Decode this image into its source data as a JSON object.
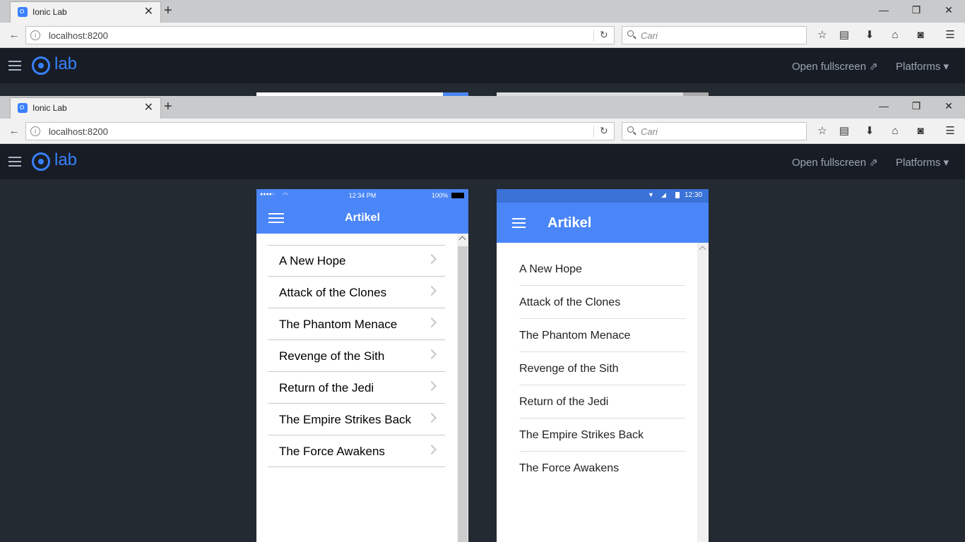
{
  "browser": {
    "tab_title": "Ionic Lab",
    "tab_close": "✕",
    "new_tab": "+",
    "url": "localhost:8200",
    "search_placeholder": "Cari",
    "win_minimize": "—",
    "win_restore": "❐",
    "win_close": "✕"
  },
  "lab": {
    "logo_text": "lab",
    "open_fullscreen": "Open fullscreen ⇗",
    "platforms": "Platforms ▾",
    "accent": "#3880ff"
  },
  "ios": {
    "time": "12:34 PM",
    "battery": "100%",
    "signal": "●●●●○",
    "title": "Artikel",
    "items": [
      "A New Hope",
      "Attack of the Clones",
      "The Phantom Menace",
      "Revenge of the Sith",
      "Return of the Jedi",
      "The Empire Strikes Back",
      "The Force Awakens"
    ]
  },
  "android": {
    "time": "12:30",
    "title": "Artikel",
    "items": [
      "A New Hope",
      "Attack of the Clones",
      "The Phantom Menace",
      "Revenge of the Sith",
      "Return of the Jedi",
      "The Empire Strikes Back",
      "The Force Awakens"
    ]
  },
  "colors": {
    "toolbar_blue": "#4a86f7",
    "lab_header": "#181d25",
    "background": "#242a31"
  }
}
